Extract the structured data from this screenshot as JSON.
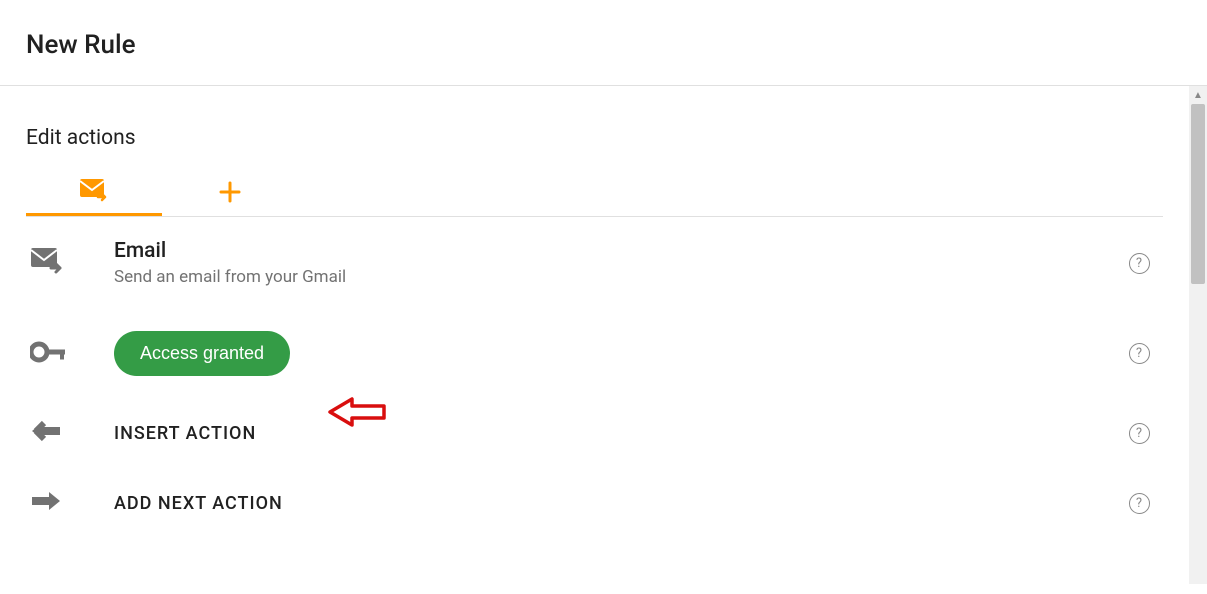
{
  "header": {
    "title": "New Rule"
  },
  "section": {
    "title": "Edit actions"
  },
  "tabs": {
    "active_icon": "email-forward-icon",
    "add_icon": "plus-icon"
  },
  "rows": {
    "email": {
      "title": "Email",
      "subtitle": "Send an email from your Gmail"
    },
    "access": {
      "button_label": "Access granted"
    },
    "insert": {
      "label": "INSERT ACTION"
    },
    "addnext": {
      "label": "ADD NEXT ACTION"
    }
  },
  "colors": {
    "accent": "#ff9800",
    "pill_green": "#349c46",
    "text_dark": "#212121",
    "text_muted": "#727272",
    "icon_gray": "#727272",
    "annotation_red": "#d90e0e"
  }
}
